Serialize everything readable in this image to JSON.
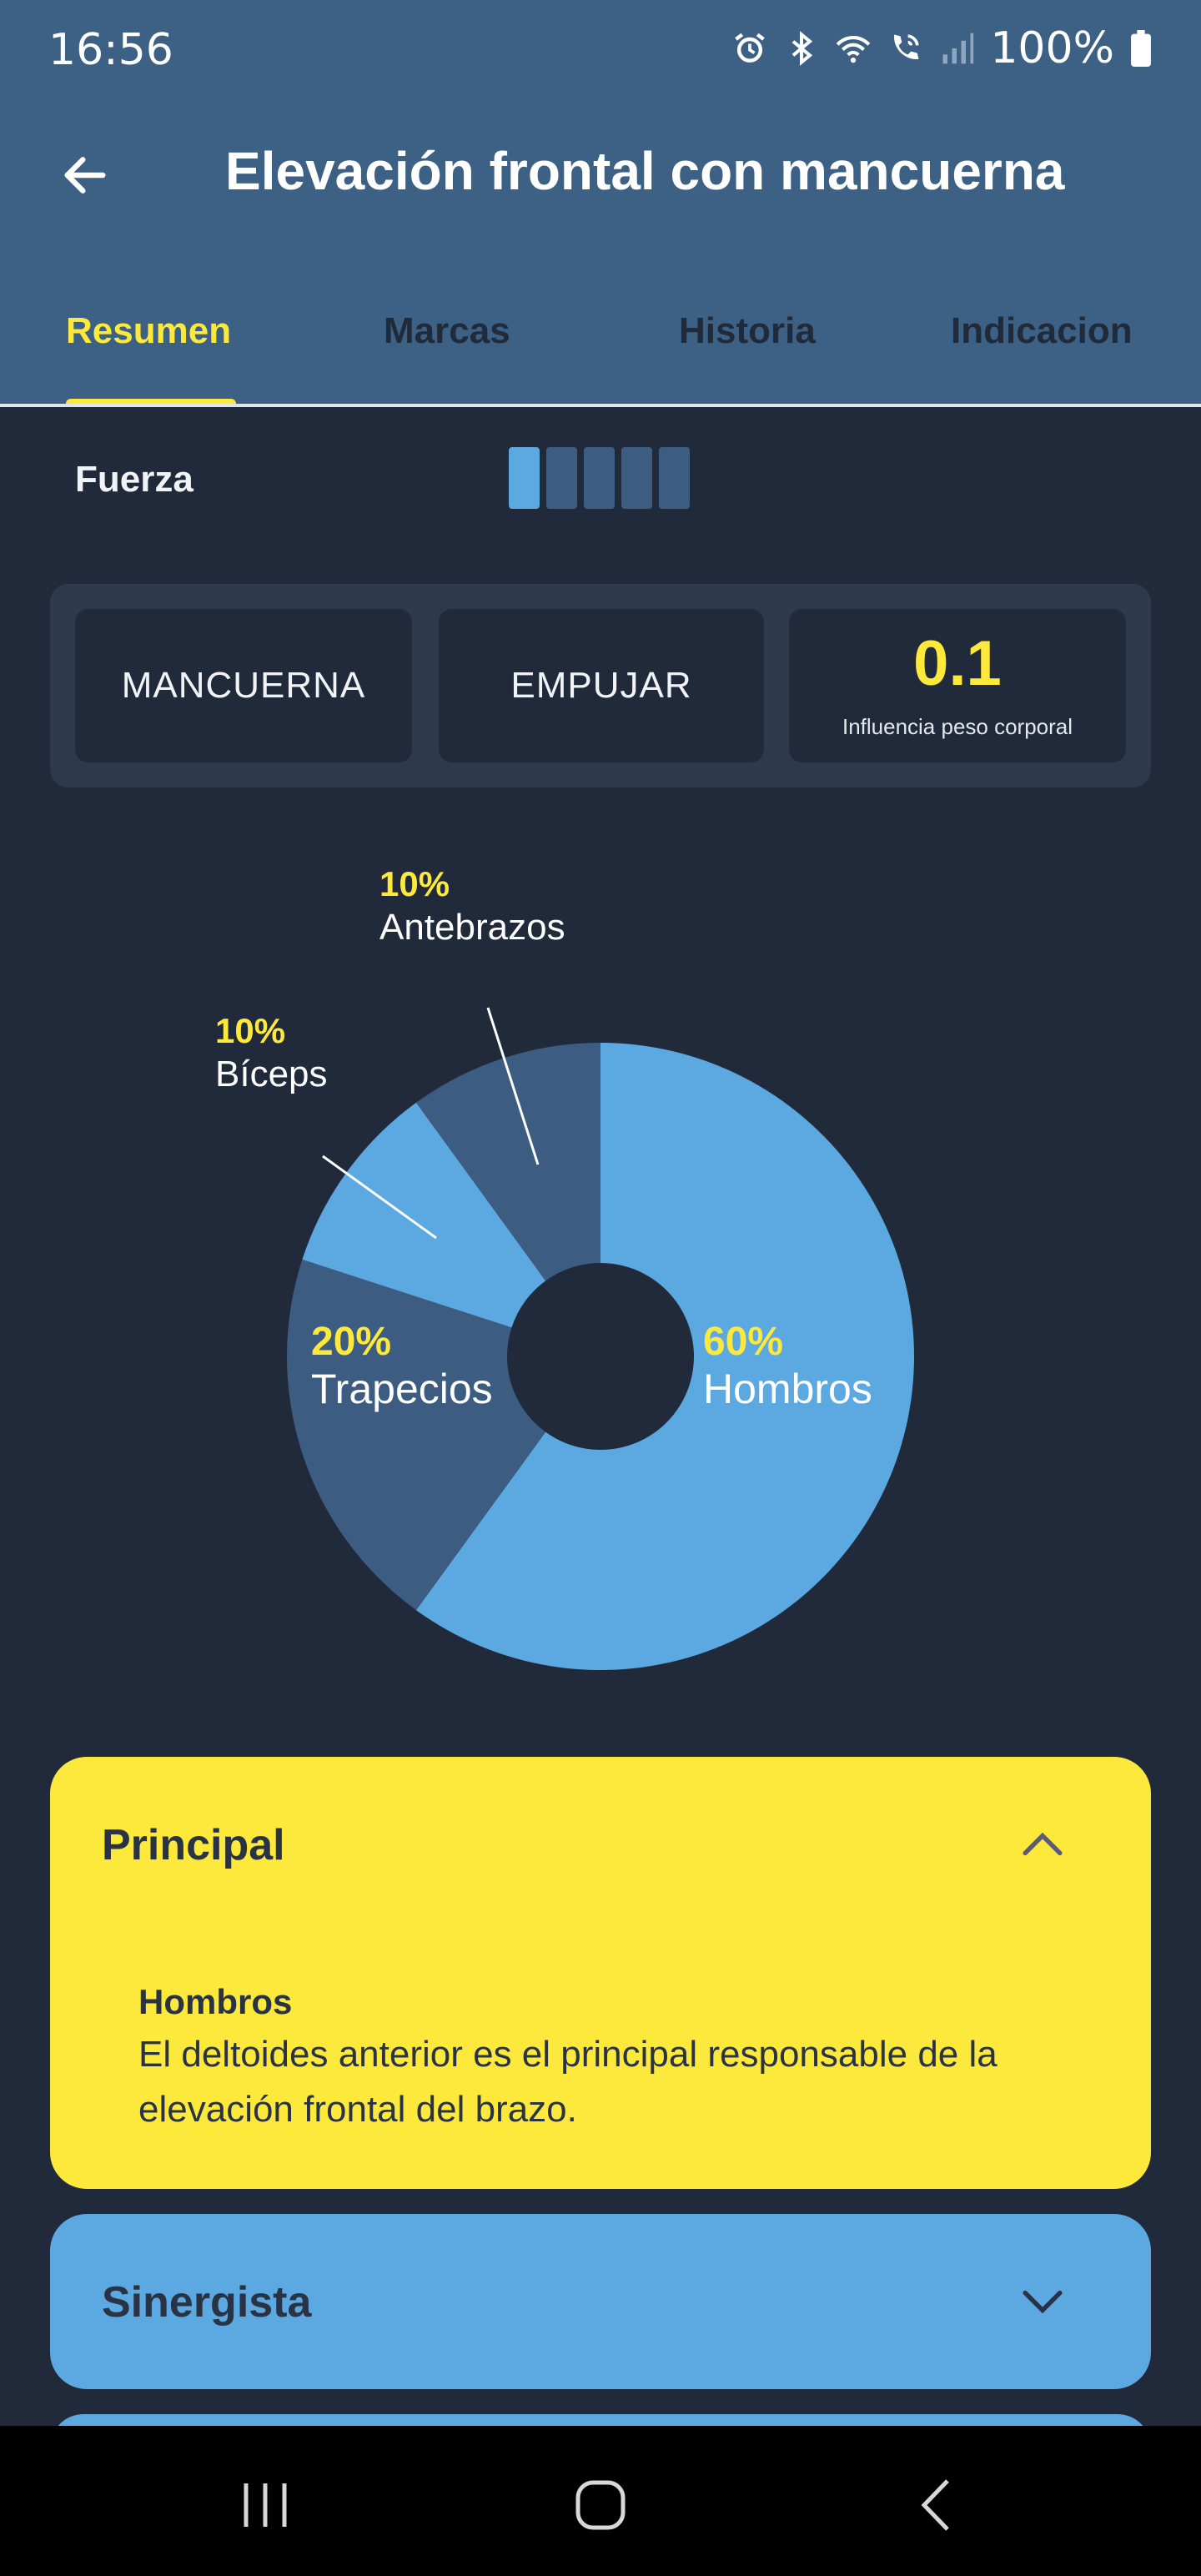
{
  "status_bar": {
    "time": "16:56",
    "battery": "100%",
    "icons": [
      "alarm-icon",
      "bluetooth-icon",
      "wifi-icon",
      "wifi-calling-icon",
      "signal-icon",
      "battery-icon"
    ]
  },
  "header": {
    "title": "Elevación frontal con mancuerna",
    "back_icon": "arrow-left-icon"
  },
  "tabs": [
    {
      "label": "Resumen",
      "active": true
    },
    {
      "label": "Marcas",
      "active": false
    },
    {
      "label": "Historia",
      "active": false
    },
    {
      "label": "Indicacion",
      "active": false
    }
  ],
  "fuerza": {
    "label": "Fuerza",
    "level": 1,
    "max": 5
  },
  "info": {
    "equipment": "MANCUERNA",
    "movement": "EMPUJAR",
    "bodyweight_value": "0.1",
    "bodyweight_label": "Influencia peso corporal"
  },
  "chart_data": {
    "type": "pie",
    "slices": [
      {
        "label": "Hombros",
        "percent_label": "60%",
        "value": 60,
        "color": "#5ca8e0"
      },
      {
        "label": "Trapecios",
        "percent_label": "20%",
        "value": 20,
        "color": "#3d5c81"
      },
      {
        "label": "Bíceps",
        "percent_label": "10%",
        "value": 10,
        "color": "#5ca8e0"
      },
      {
        "label": "Antebrazos",
        "percent_label": "10%",
        "value": 10,
        "color": "#3d5c81"
      }
    ],
    "colors": {
      "label_percent": "#fde93b",
      "label_name": "#ffffff"
    }
  },
  "accordions": {
    "principal": {
      "title": "Principal",
      "expanded": true,
      "muscle": "Hombros",
      "description": "El deltoides anterior es el principal responsable de la elevación frontal del brazo."
    },
    "sinergista": {
      "title": "Sinergista",
      "expanded": false
    }
  },
  "colors": {
    "header_bg": "#3d6085",
    "page_bg": "#212a3a",
    "accent_yellow": "#fde93b",
    "accent_blue": "#5ca8e0"
  }
}
